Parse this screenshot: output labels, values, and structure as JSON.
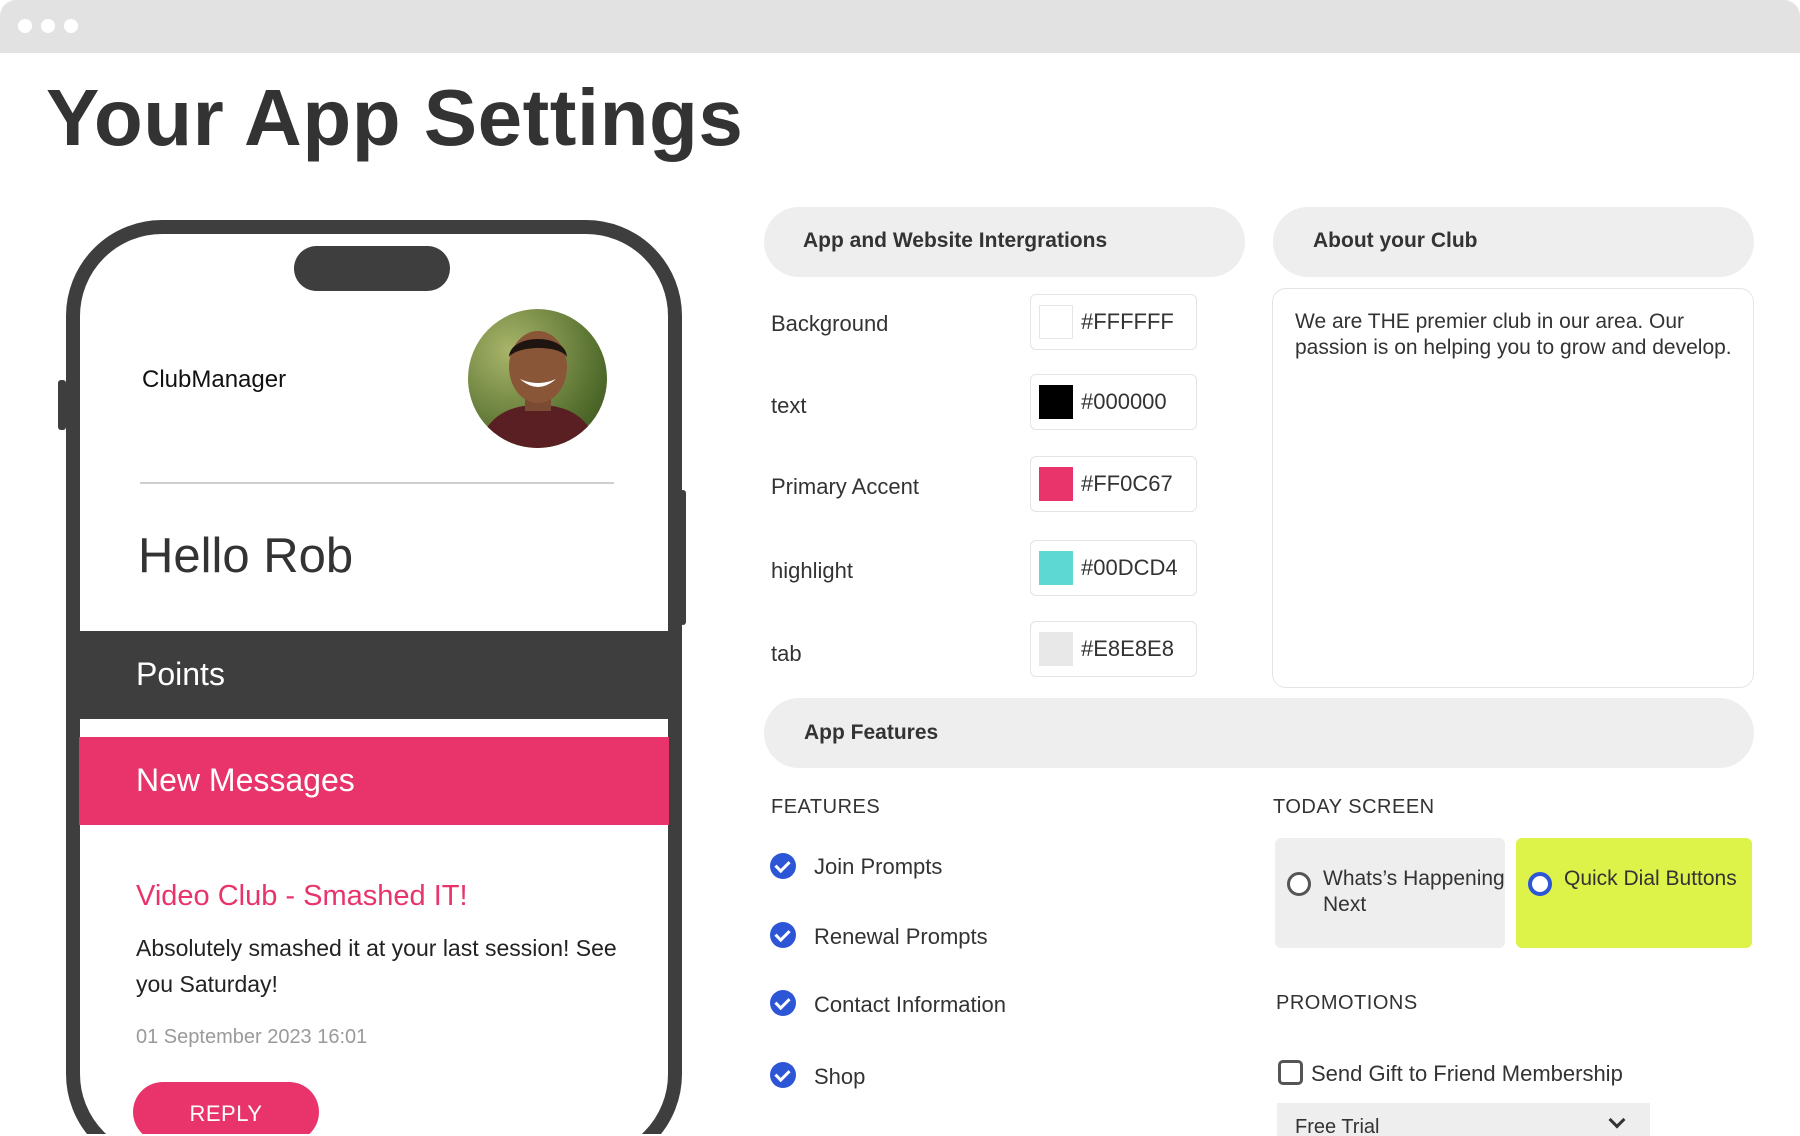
{
  "page": {
    "title": "Your App Settings"
  },
  "phone_preview": {
    "brand": "ClubManager",
    "greeting": "Hello Rob",
    "points_label": "Points",
    "messages_label": "New Messages",
    "message": {
      "title": "Video Club - Smashed IT!",
      "body": "Absolutely smashed it at your last session! See you Saturday!",
      "timestamp": "01 September 2023 16:01",
      "reply_label": "REPLY"
    }
  },
  "integrations": {
    "title": "App and Website Intergrations",
    "colors": [
      {
        "label": "Background",
        "hex": "#FFFFFF",
        "swatch": "#FFFFFF"
      },
      {
        "label": "text",
        "hex": "#000000",
        "swatch": "#000000"
      },
      {
        "label": "Primary Accent",
        "hex": "#FF0C67",
        "swatch": "#E8346A"
      },
      {
        "label": "highlight",
        "hex": "#00DCD4",
        "swatch": "#5ED8D2"
      },
      {
        "label": "tab",
        "hex": "#E8E8E8",
        "swatch": "#E8E8E8"
      }
    ]
  },
  "about": {
    "title": "About your Club",
    "text": "We are THE premier club in our area. Our passion is on helping you to grow and develop."
  },
  "features": {
    "title": "App Features",
    "features_heading": "FEATURES",
    "items": [
      {
        "label": "Join Prompts",
        "checked": true
      },
      {
        "label": "Renewal Prompts",
        "checked": true
      },
      {
        "label": "Contact Information",
        "checked": true
      },
      {
        "label": "Shop",
        "checked": true
      }
    ],
    "today_screen_heading": "TODAY SCREEN",
    "today_screen_options": [
      {
        "label": "Whats’s Happening Next",
        "selected": false
      },
      {
        "label": "Quick Dial Buttons",
        "selected": true
      }
    ],
    "promotions_heading": "PROMOTIONS",
    "promotion_checkbox": {
      "label": "Send Gift to Friend Membership",
      "checked": false
    },
    "promotion_select": {
      "value": "Free Trial"
    }
  },
  "colors": {
    "accent_pink": "#E8346A",
    "dark": "#3E3E3E",
    "check_blue": "#2D56D6",
    "highlight_lime": "#DDF34A",
    "pill_bg": "#EEEEEE"
  }
}
